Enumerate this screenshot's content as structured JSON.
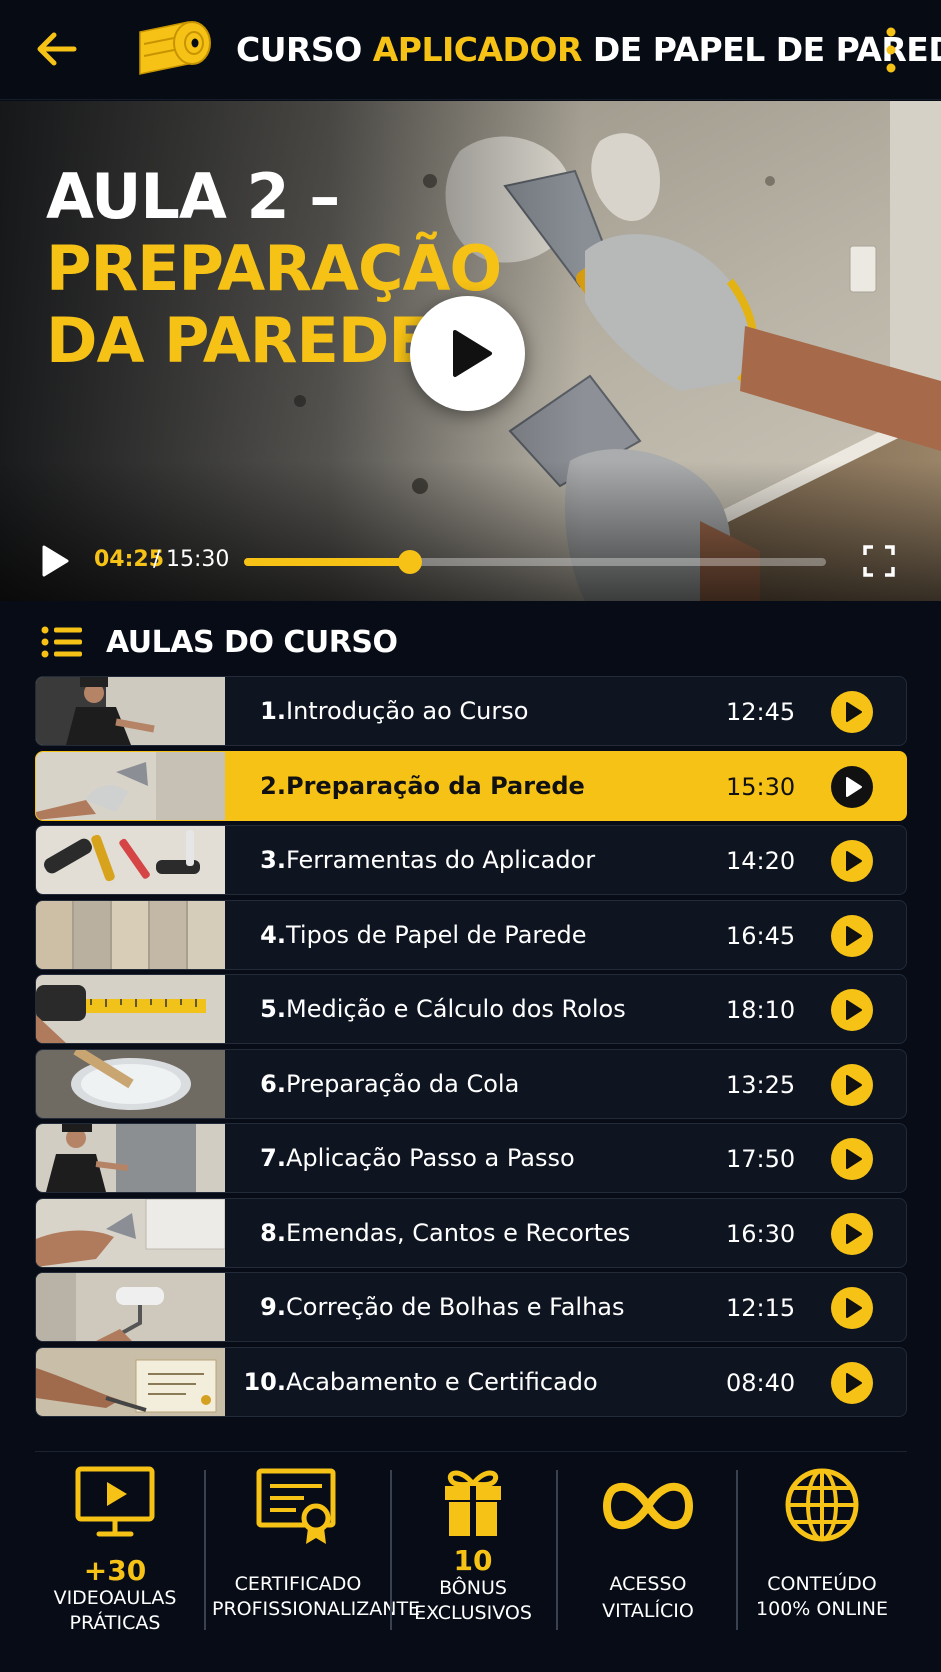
{
  "header": {
    "title_part1": "CURSO ",
    "title_highlight": "APLICADOR",
    "title_part2": " DE PAPEL DE PAREDE",
    "back_icon": "arrow-left-icon",
    "logo_icon": "wallpaper-roll-icon",
    "menu_icon": "more-vertical-icon"
  },
  "video": {
    "heading_line1": "AULA 2 –",
    "heading_line2": "PREPARAÇÃO",
    "heading_line3": "DA PAREDE",
    "current_time": "04:25",
    "separator": "/",
    "duration": "15:30",
    "progress_fraction": 0.285
  },
  "section": {
    "title": "AULAS DO CURSO",
    "icon": "list-icon"
  },
  "lessons": [
    {
      "number": "1.",
      "title": "Introdução ao Curso",
      "duration": "12:45",
      "active": false
    },
    {
      "number": "2.",
      "title": "Preparação da Parede",
      "duration": "15:30",
      "active": true
    },
    {
      "number": "3.",
      "title": "Ferramentas do Aplicador",
      "duration": "14:20",
      "active": false
    },
    {
      "number": "4.",
      "title": "Tipos de Papel de Parede",
      "duration": "16:45",
      "active": false
    },
    {
      "number": "5.",
      "title": "Medição e Cálculo dos Rolos",
      "duration": "18:10",
      "active": false
    },
    {
      "number": "6.",
      "title": "Preparação da Cola",
      "duration": "13:25",
      "active": false
    },
    {
      "number": "7.",
      "title": "Aplicação Passo a Passo",
      "duration": "17:50",
      "active": false
    },
    {
      "number": "8.",
      "title": "Emendas, Cantos e Recortes",
      "duration": "16:30",
      "active": false
    },
    {
      "number": "9.",
      "title": "Correção de Bolhas e Falhas",
      "duration": "12:15",
      "active": false
    },
    {
      "number": "10.",
      "title": "Acabamento e Certificado",
      "duration": "08:40",
      "active": false
    }
  ],
  "features": [
    {
      "icon": "monitor-play-icon",
      "big": "+30",
      "line1": "VIDEOAULAS",
      "line2": "PRÁTICAS"
    },
    {
      "icon": "certificate-icon",
      "big": "",
      "line1": "CERTIFICADO",
      "line2": "PROFISSIONALIZANTE"
    },
    {
      "icon": "gift-icon",
      "big": "10",
      "line1": "BÔNUS",
      "line2": "EXCLUSIVOS"
    },
    {
      "icon": "infinity-icon",
      "big": "",
      "line1": "ACESSO",
      "line2": "VITALÍCIO"
    },
    {
      "icon": "globe-icon",
      "big": "",
      "line1": "CONTEÚDO",
      "line2": "100% ONLINE"
    }
  ],
  "colors": {
    "accent": "#f6c216",
    "background": "#070c16",
    "card": "#0e1420",
    "text": "#ffffff"
  }
}
